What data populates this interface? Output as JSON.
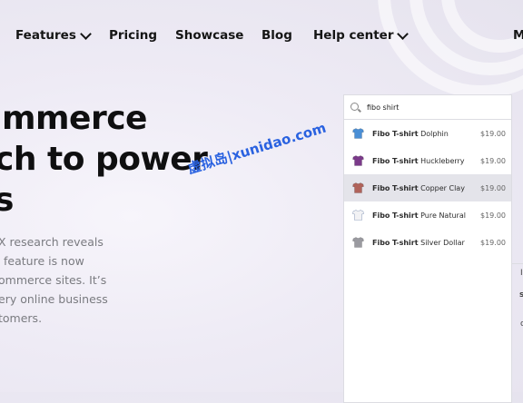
{
  "nav": {
    "features": "Features",
    "pricing": "Pricing",
    "showcase": "Showcase",
    "blog": "Blog",
    "help_center": "Help center",
    "cut_item": "M"
  },
  "hero": {
    "title_lines": [
      "mmerce",
      "ch to power",
      "s"
    ],
    "body_lines": [
      "X research reveals",
      "feature is now",
      "ommerce sites. It’s",
      "ery online business",
      "tomers."
    ]
  },
  "watermark": "虚拟岛|xunidao.com",
  "search": {
    "value": "fibo shirt"
  },
  "results": [
    {
      "brand": "Fibo",
      "type": "T-shirt",
      "variant": "Dolphin",
      "price": "$19.00",
      "color": "#4a8fd6"
    },
    {
      "brand": "Fibo",
      "type": "T-shirt",
      "variant": "Huckleberry",
      "price": "$19.00",
      "color": "#7b3a8a"
    },
    {
      "brand": "Fibo",
      "type": "T-shirt",
      "variant": "Copper Clay",
      "price": "$19.00",
      "color": "#b0635a"
    },
    {
      "brand": "Fibo",
      "type": "T-shirt",
      "variant": "Pure Natural",
      "price": "$19.00",
      "color": "#f2f2f4"
    },
    {
      "brand": "Fibo",
      "type": "T-shirt",
      "variant": "Silver Dollar",
      "price": "$19.00",
      "color": "#9a9aa0"
    }
  ],
  "active_result_index": 2,
  "side": {
    "mark1": "I",
    "mark2": "s",
    "mark3": "c"
  }
}
